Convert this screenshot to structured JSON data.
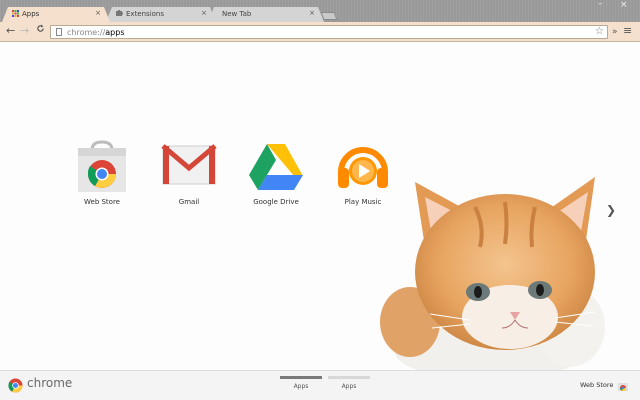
{
  "tabs": [
    {
      "label": "Apps",
      "close": "×",
      "active": true
    },
    {
      "label": "Extensions",
      "close": "×",
      "active": false
    },
    {
      "label": "New Tab",
      "close": "×",
      "active": false
    }
  ],
  "window_controls": {
    "minimize": "–",
    "close": "×"
  },
  "toolbar": {
    "back": "←",
    "forward": "→",
    "reload": "C",
    "url_scheme": "chrome://",
    "url_host": "apps",
    "star": "☆",
    "extensions": "»",
    "menu": "≡"
  },
  "apps": [
    {
      "label": "Web Store",
      "icon": "webstore-icon"
    },
    {
      "label": "Gmail",
      "icon": "gmail-icon"
    },
    {
      "label": "Google Drive",
      "icon": "google-drive-icon"
    },
    {
      "label": "Play Music",
      "icon": "play-music-icon"
    }
  ],
  "next_page": "❯",
  "bottom": {
    "brand": "chrome",
    "pages": [
      {
        "label": "Apps",
        "selected": true
      },
      {
        "label": "Apps",
        "selected": false
      }
    ],
    "webstore_label": "Web Store"
  },
  "colors": {
    "tab_active": "#f4e0cc",
    "gmail_red": "#d44638",
    "drive_yellow": "#ffc107",
    "drive_green": "#1da261",
    "drive_blue": "#4285f4",
    "play_music_orange": "#ff8a00",
    "kitten_fur": "#e8a561"
  }
}
